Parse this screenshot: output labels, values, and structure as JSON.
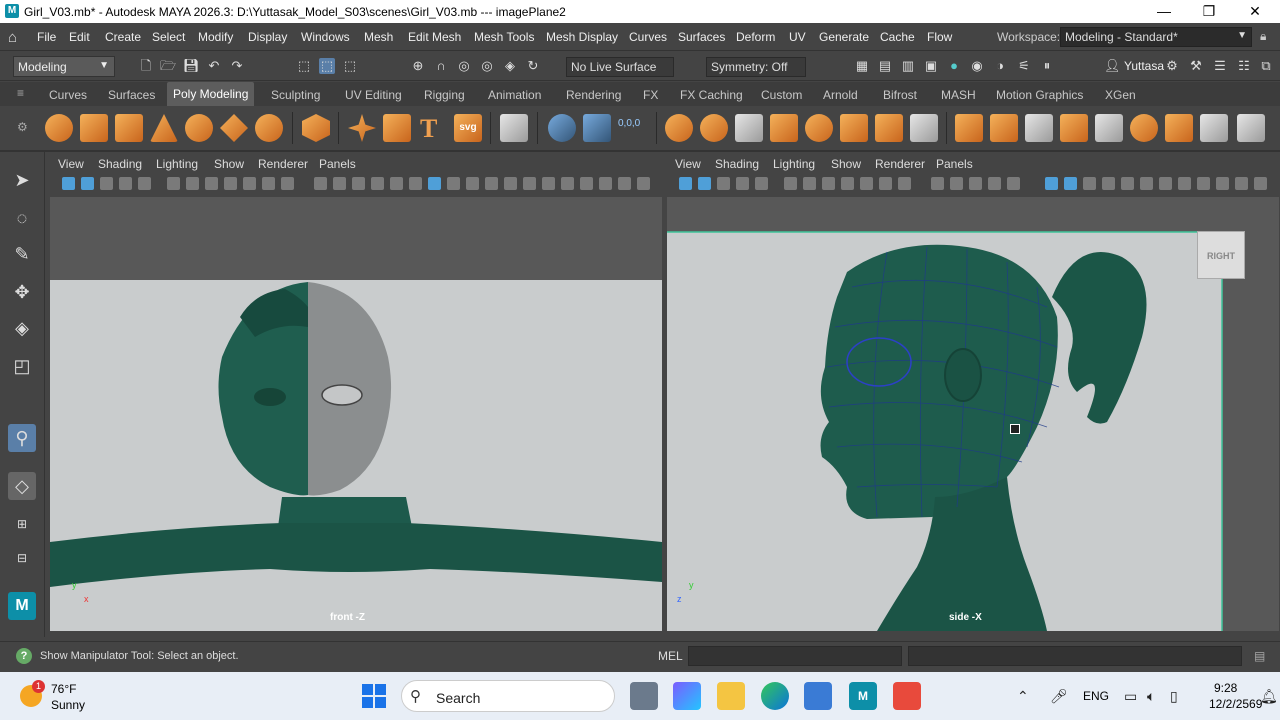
{
  "window": {
    "title": "Girl_V03.mb* - Autodesk MAYA 2026.3: D:\\Yuttasak_Model_S03\\scenes\\Girl_V03.mb  ---  imagePlane2",
    "app_icon": "M"
  },
  "menubar": {
    "items": [
      "File",
      "Edit",
      "Create",
      "Select",
      "Modify",
      "Display",
      "Windows",
      "Mesh",
      "Edit Mesh",
      "Mesh Tools",
      "Mesh Display",
      "Curves",
      "Surfaces",
      "Deform",
      "UV",
      "Generate",
      "Cache",
      "Flow"
    ],
    "workspace_label": "Workspace:",
    "workspace_value": "Modeling - Standard*"
  },
  "statusline": {
    "mode": "Modeling",
    "live_surface": "No Live Surface",
    "symmetry": "Symmetry: Off",
    "user": "Yuttasa"
  },
  "shelf": {
    "tabs": [
      "Curves",
      "Surfaces",
      "Poly Modeling",
      "Sculpting",
      "UV Editing",
      "Rigging",
      "Animation",
      "Rendering",
      "FX",
      "FX Caching",
      "Custom",
      "Arnold",
      "Bifrost",
      "MASH",
      "Motion Graphics",
      "XGen"
    ],
    "active_tab": "Poly Modeling",
    "text_tool": "T",
    "svg_tool": "svg",
    "coords_tool": "0,0,0"
  },
  "panel_menu": [
    "View",
    "Shading",
    "Lighting",
    "Show",
    "Renderer",
    "Panels"
  ],
  "viewports": {
    "left": {
      "camera": "front -Z"
    },
    "right": {
      "camera": "side -X",
      "viewcube": "RIGHT"
    }
  },
  "helpline": {
    "text": "Show Manipulator Tool: Select an object.",
    "mel_label": "MEL"
  },
  "taskbar": {
    "weather_temp": "76°F",
    "weather_desc": "Sunny",
    "weather_badge": "1",
    "search_label": "Search",
    "language": "ENG",
    "time": "9:28",
    "date": "12/2/2569"
  }
}
